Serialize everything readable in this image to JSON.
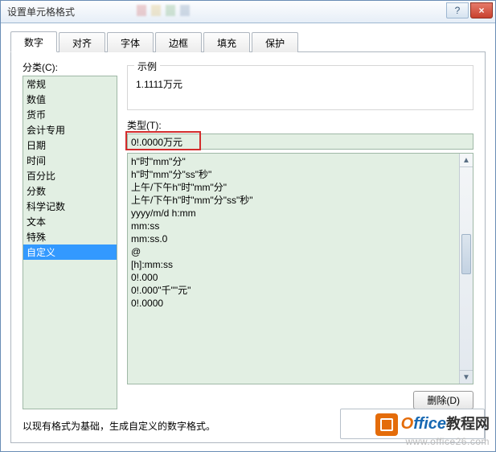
{
  "window": {
    "title": "设置单元格格式"
  },
  "tabs": [
    {
      "label": "数字",
      "active": true
    },
    {
      "label": "对齐"
    },
    {
      "label": "字体"
    },
    {
      "label": "边框"
    },
    {
      "label": "填充"
    },
    {
      "label": "保护"
    }
  ],
  "category": {
    "label": "分类(C):",
    "items": [
      "常规",
      "数值",
      "货币",
      "会计专用",
      "日期",
      "时间",
      "百分比",
      "分数",
      "科学记数",
      "文本",
      "特殊",
      "自定义"
    ],
    "selected_index": 11
  },
  "example": {
    "title": "示例",
    "value": "1.1111万元"
  },
  "type": {
    "label": "类型(T):",
    "value": "0!.0000万元",
    "formats": [
      "h\"时\"mm\"分\"",
      "h\"时\"mm\"分\"ss\"秒\"",
      "上午/下午h\"时\"mm\"分\"",
      "上午/下午h\"时\"mm\"分\"ss\"秒\"",
      "yyyy/m/d h:mm",
      "mm:ss",
      "mm:ss.0",
      "@",
      "[h]:mm:ss",
      "0!.000",
      "0!.000\"千\"\"元\"",
      "0!.0000"
    ]
  },
  "buttons": {
    "delete": "删除(D)"
  },
  "hint": "以现有格式为基础，生成自定义的数字格式。",
  "watermark": {
    "brand_o": "O",
    "brand_rest": "ffice",
    "brand_cn": "教程网",
    "url": "www.office26.com"
  }
}
